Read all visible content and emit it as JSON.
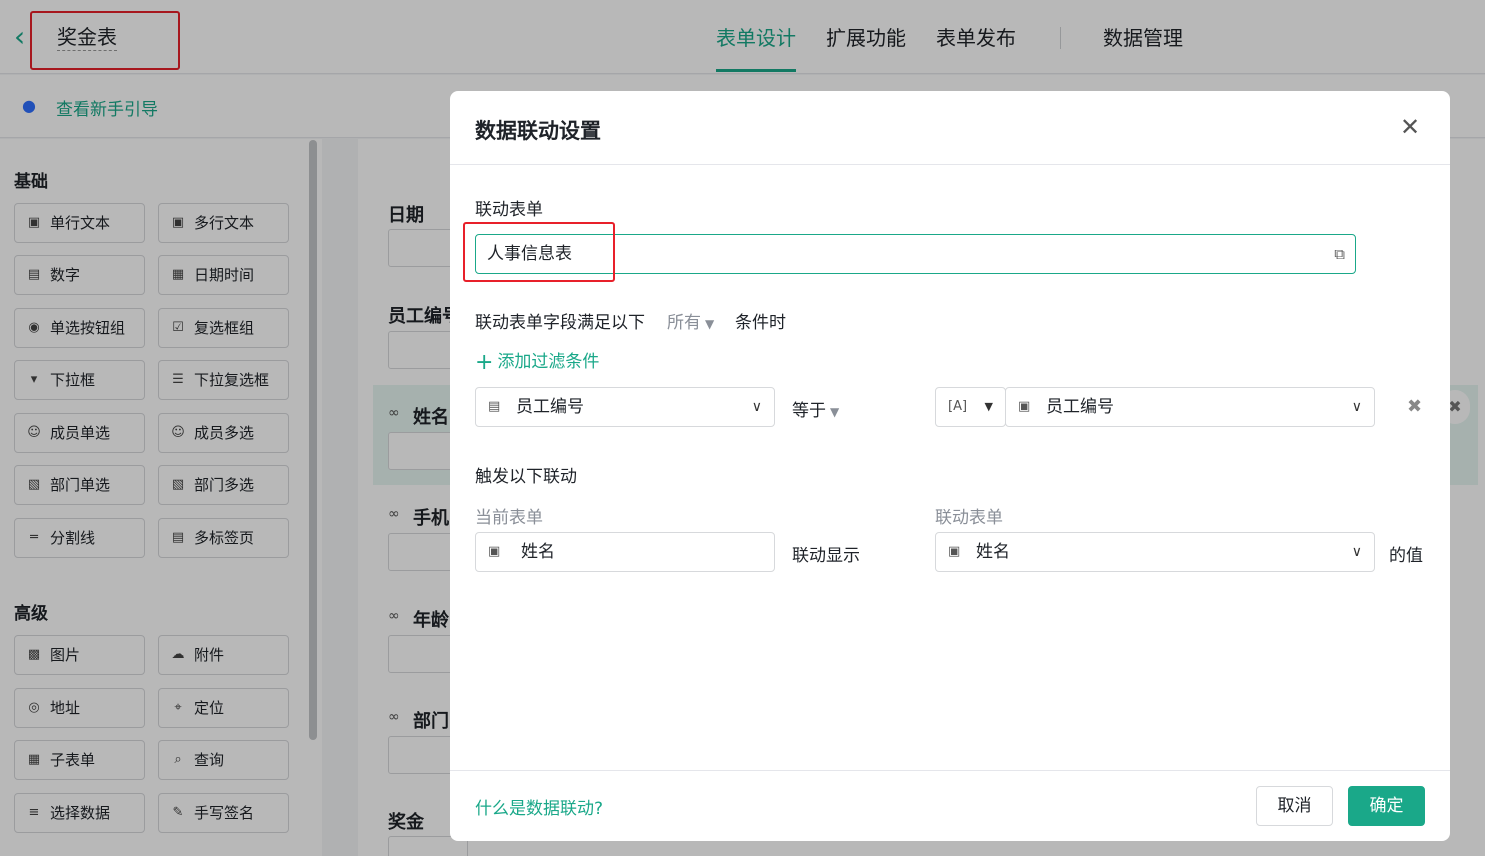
{
  "header": {
    "form_title": "奖金表",
    "tabs": [
      "表单设计",
      "扩展功能",
      "表单发布",
      "数据管理"
    ],
    "guide_text": "查看新手引导"
  },
  "sidebar": {
    "basic_title": "基础",
    "basic_items": [
      "单行文本",
      "多行文本",
      "数字",
      "日期时间",
      "单选按钮组",
      "复选框组",
      "下拉框",
      "下拉复选框",
      "成员单选",
      "成员多选",
      "部门单选",
      "部门多选",
      "分割线",
      "多标签页"
    ],
    "advanced_title": "高级",
    "advanced_items": [
      "图片",
      "附件",
      "地址",
      "定位",
      "子表单",
      "查询",
      "选择数据",
      "手写签名"
    ]
  },
  "canvas": {
    "fields": [
      "日期",
      "员工编号",
      "姓名",
      "手机",
      "年龄",
      "部门",
      "奖金"
    ]
  },
  "modal": {
    "title": "数据联动设置",
    "linked_form_label": "联动表单",
    "linked_form_value": "人事信息表",
    "condition_prefix": "联动表单字段满足以下",
    "condition_mode": "所有",
    "condition_suffix": "条件时",
    "add_filter": "添加过滤条件",
    "filter_field": "员工编号",
    "filter_operator": "等于",
    "filter_value_type": "A",
    "filter_value_field": "员工编号",
    "trigger_label": "触发以下联动",
    "current_form_label": "当前表单",
    "linked_form_col_label": "联动表单",
    "current_field": "姓名",
    "link_action": "联动显示",
    "linked_field": "姓名",
    "value_suffix": "的值",
    "help_link": "什么是数据联动?",
    "cancel": "取消",
    "confirm": "确定"
  }
}
